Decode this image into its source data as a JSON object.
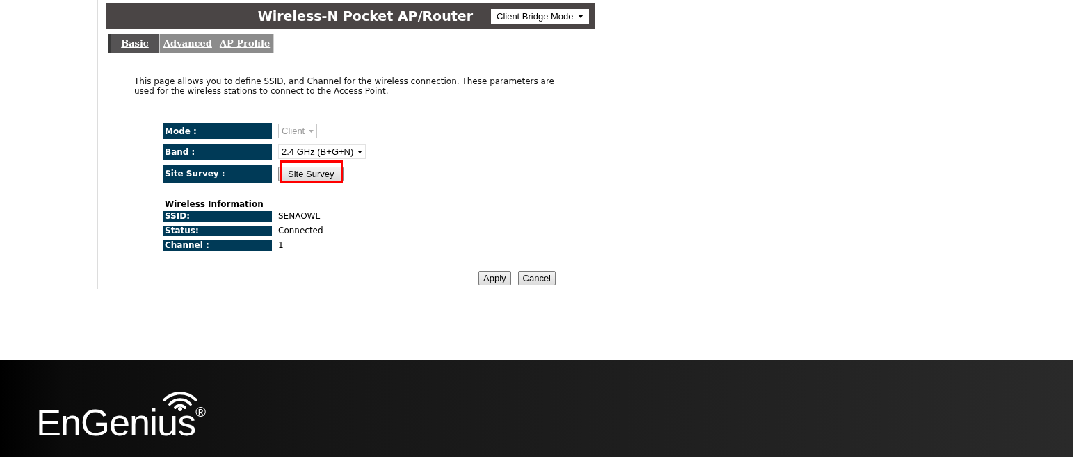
{
  "header": {
    "title": "Wireless-N Pocket AP/Router",
    "mode_select": {
      "value": "Client Bridge Mode"
    }
  },
  "tabs": [
    {
      "label": "Basic",
      "selected": true
    },
    {
      "label": "Advanced",
      "selected": false
    },
    {
      "label": "AP Profile",
      "selected": false
    }
  ],
  "description": "This page allows you to define SSID, and Channel for the wireless connection. These parameters are used for the wireless stations to connect to the Access Point.",
  "form": [
    {
      "kind": "select",
      "label": "Mode :",
      "value": "Client",
      "disabled": true
    },
    {
      "kind": "select",
      "label": "Band :",
      "value": "2.4 GHz (B+G+N)",
      "disabled": false
    },
    {
      "kind": "button",
      "label": "Site Survey :",
      "value": "Site Survey",
      "highlighted": true
    }
  ],
  "wireless_information": {
    "title": "Wireless Information",
    "rows": [
      {
        "label": "SSID:",
        "value": "SENAOWL"
      },
      {
        "label": "Status:",
        "value": "Connected"
      },
      {
        "label": "Channel :",
        "value": "1"
      }
    ]
  },
  "buttons": [
    "Apply",
    "Cancel"
  ],
  "footer": {
    "logo": "EnGenius",
    "registered": "®"
  }
}
